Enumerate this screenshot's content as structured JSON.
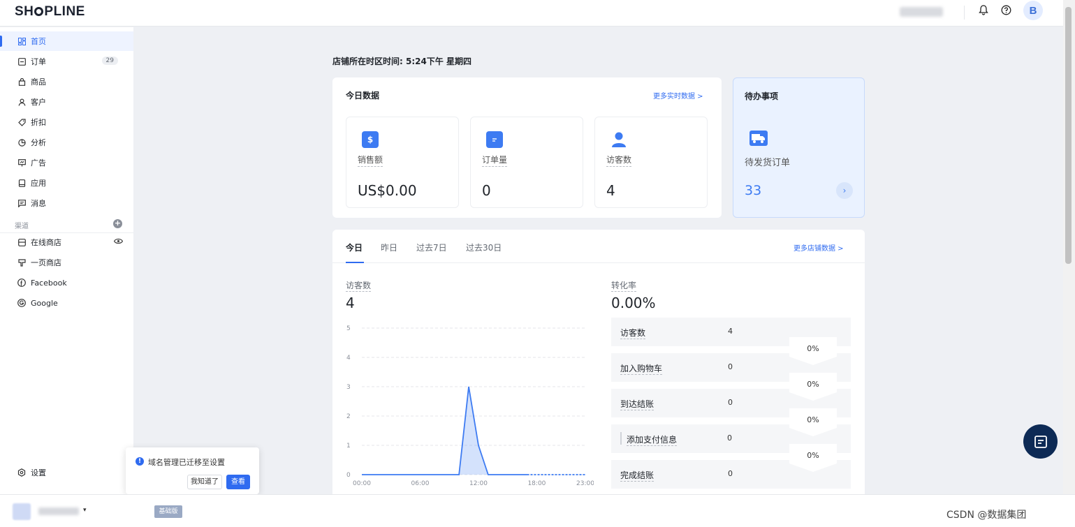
{
  "header": {
    "logo_pre": "SH",
    "logo_post": "PLINE",
    "avatar_letter": "B"
  },
  "sidebar": {
    "items": [
      {
        "label": "首页",
        "icon": "grid-icon",
        "active": true
      },
      {
        "label": "订单",
        "icon": "order-icon",
        "badge": "29"
      },
      {
        "label": "商品",
        "icon": "bag-icon"
      },
      {
        "label": "客户",
        "icon": "user-icon"
      },
      {
        "label": "折扣",
        "icon": "tag-icon"
      },
      {
        "label": "分析",
        "icon": "chart-pie-icon"
      },
      {
        "label": "广告",
        "icon": "ad-icon"
      },
      {
        "label": "应用",
        "icon": "app-icon"
      },
      {
        "label": "消息",
        "icon": "message-icon"
      }
    ],
    "channels_label": "渠道",
    "channels": [
      {
        "label": "在线商店",
        "icon": "store-icon"
      },
      {
        "label": "一页商店",
        "icon": "one-page-icon"
      },
      {
        "label": "Facebook",
        "icon": "facebook-icon"
      },
      {
        "label": "Google",
        "icon": "google-icon"
      }
    ],
    "settings_label": "设置"
  },
  "toast": {
    "message": "域名管理已迁移至设置",
    "dismiss_label": "我知道了",
    "view_label": "查看"
  },
  "bottombar": {
    "plan_badge": "基础版",
    "watermark": "CSDN @数据集团"
  },
  "main": {
    "timezone_label": "店铺所在时区时间: 5:24下午 星期四",
    "today": {
      "title": "今日数据",
      "more_label": "更多实时数据 >",
      "metrics": [
        {
          "label": "销售额",
          "value": "US$0.00",
          "icon": "dollar-icon"
        },
        {
          "label": "订单量",
          "value": "0",
          "icon": "document-icon"
        },
        {
          "label": "访客数",
          "value": "4",
          "icon": "person-icon"
        }
      ]
    },
    "todo": {
      "title": "待办事项",
      "label": "待发货订单",
      "value": "33"
    },
    "analytics": {
      "tabs": [
        "今日",
        "昨日",
        "过去7日",
        "过去30日"
      ],
      "more_label": "更多店铺数据 >",
      "visitors_label": "访客数",
      "visitors_value": "4",
      "conversion_label": "转化率",
      "conversion_value": "0.00%",
      "funnel": [
        {
          "name": "访客数",
          "value": "4"
        },
        {
          "name": "加入购物车",
          "value": "0"
        },
        {
          "name": "到达结账",
          "value": "0"
        },
        {
          "name": "添加支付信息",
          "value": "0"
        },
        {
          "name": "完成结账",
          "value": "0"
        }
      ],
      "funnel_rates": [
        "0%",
        "0%",
        "0%",
        "0%"
      ]
    }
  },
  "chart_data": {
    "type": "area",
    "x": [
      "00:00",
      "01:00",
      "02:00",
      "03:00",
      "04:00",
      "05:00",
      "06:00",
      "07:00",
      "08:00",
      "09:00",
      "10:00",
      "11:00",
      "12:00",
      "13:00",
      "14:00",
      "15:00",
      "16:00",
      "17:00",
      "18:00",
      "19:00",
      "20:00",
      "21:00",
      "22:00",
      "23:00"
    ],
    "values": [
      0,
      0,
      0,
      0,
      0,
      0,
      0,
      0,
      0,
      0,
      0,
      3,
      1,
      0,
      0,
      0,
      0,
      0,
      null,
      null,
      null,
      null,
      null,
      null
    ],
    "xticks": [
      "00:00",
      "06:00",
      "12:00",
      "18:00",
      "23:00"
    ],
    "yticks": [
      0,
      1,
      2,
      3,
      4,
      5
    ],
    "ylim": [
      0,
      5
    ],
    "grid": true,
    "color": "#3d7bf2"
  }
}
